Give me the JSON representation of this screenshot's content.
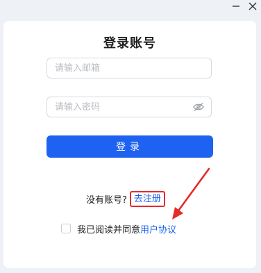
{
  "window": {
    "minimize_icon": "minimize-icon",
    "close_icon": "close-icon"
  },
  "login": {
    "title": "登录账号",
    "email_placeholder": "请输入邮箱",
    "email_value": "",
    "password_placeholder": "请输入密码",
    "password_value": "",
    "password_toggle_icon": "eye-hidden-icon",
    "submit_label": "登录"
  },
  "register": {
    "prompt": "没有账号?",
    "link": "去注册"
  },
  "agreement": {
    "checked": false,
    "text": "我已阅读并同意",
    "link": "用户协议"
  },
  "annotation": {
    "highlight_color": "#e52a2a"
  },
  "colors": {
    "accent": "#1d62f0",
    "background": "#eef1f6"
  }
}
